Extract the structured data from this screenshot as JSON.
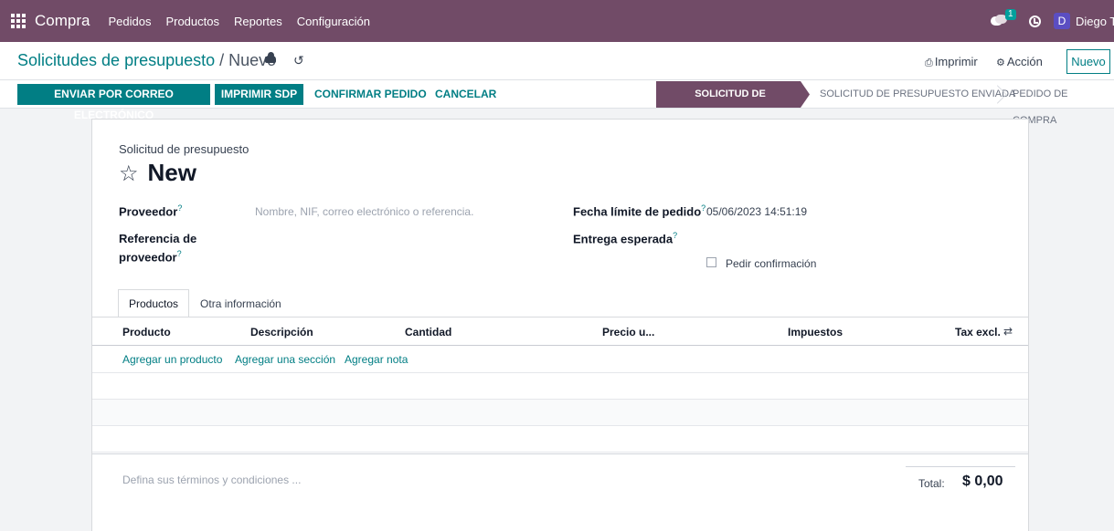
{
  "navbar": {
    "app_name": "Compra",
    "menu": [
      "Pedidos",
      "Productos",
      "Reportes",
      "Configuración"
    ],
    "chat_count": "1",
    "user_initial": "D",
    "user_name": "Diego Torres"
  },
  "control_panel": {
    "breadcrumb_parent": "Solicitudes de presupuesto",
    "breadcrumb_separator": " / ",
    "breadcrumb_current": "Nuevo",
    "print_label": "Imprimir",
    "action_label": "Acción",
    "new_label": "Nuevo"
  },
  "statusbar": {
    "buttons": [
      "ENVIAR POR CORREO ELECTRÓNICO",
      "IMPRIMIR SDP",
      "CONFIRMAR PEDIDO",
      "CANCELAR"
    ],
    "stages": [
      "SOLICITUD DE PRESUPUESTO",
      "SOLICITUD DE PRESUPUESTO ENVIADA",
      "PEDIDO DE COMPRA"
    ],
    "active_stage": "SOLICITUD DE PRESUPUESTO"
  },
  "form": {
    "subtitle": "Solicitud de presupuesto",
    "title": "New",
    "vendor_label": "Proveedor",
    "vendor_placeholder": "Nombre, NIF, correo electrónico o referencia.",
    "vendor_ref_label_1": "Referencia de",
    "vendor_ref_label_2": "proveedor",
    "deadline_label": "Fecha límite de pedido",
    "deadline_value": "05/06/2023 14:51:19",
    "expected_label": "Entrega esperada",
    "confirm_label": "Pedir confirmación",
    "help_mark": "?",
    "tabs": [
      "Productos",
      "Otra información"
    ],
    "columns": [
      "Producto",
      "Descripción",
      "Cantidad",
      "Precio u...",
      "Impuestos",
      "Tax excl."
    ],
    "add_links": [
      "Agregar un producto",
      "Agregar una sección",
      "Agregar nota"
    ],
    "terms_placeholder": "Defina sus términos y condiciones ...",
    "total_label": "Total:",
    "total_value": "$ 0,00"
  },
  "colors": {
    "brand": "#714b67",
    "accent": "#017e84"
  }
}
